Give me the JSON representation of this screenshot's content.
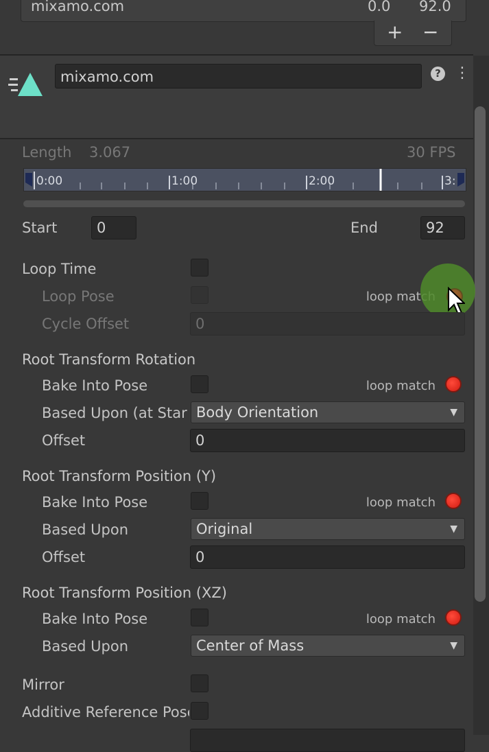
{
  "top_clip": {
    "name": "mixamo.com",
    "start": "0.0",
    "end": "92.0"
  },
  "list_controls": {
    "add": "+",
    "remove": "−"
  },
  "header": {
    "clip_name": "mixamo.com",
    "help_icon": "?",
    "menu_icon": "⋮"
  },
  "timeline": {
    "length_label": "Length",
    "length_value": "3.067",
    "fps": "30 FPS",
    "ticks": [
      "0:00",
      "1:00",
      "2:00",
      "3:"
    ]
  },
  "range": {
    "start_label": "Start",
    "start_value": "0",
    "end_label": "End",
    "end_value": "92"
  },
  "loop": {
    "loop_time_label": "Loop Time",
    "loop_pose_label": "Loop Pose",
    "cycle_offset_label": "Cycle Offset",
    "cycle_offset_value": "0",
    "loop_match_label": "loop match"
  },
  "root_rotation": {
    "title": "Root Transform Rotation",
    "bake_label": "Bake Into Pose",
    "loop_match_label": "loop match",
    "based_upon_label": "Based Upon (at Start)",
    "based_upon_value": "Body Orientation",
    "offset_label": "Offset",
    "offset_value": "0"
  },
  "root_position_y": {
    "title": "Root Transform Position (Y)",
    "bake_label": "Bake Into Pose",
    "loop_match_label": "loop match",
    "based_upon_label": "Based Upon",
    "based_upon_value": "Original",
    "offset_label": "Offset",
    "offset_value": "0"
  },
  "root_position_xz": {
    "title": "Root Transform Position (XZ)",
    "bake_label": "Bake Into Pose",
    "loop_match_label": "loop match",
    "based_upon_label": "Based Upon",
    "based_upon_value": "Center of Mass"
  },
  "mirror_label": "Mirror",
  "additive_label": "Additive Reference Pose",
  "colors": {
    "background": "#383838",
    "loop_red": "#e0261a",
    "cursor_highlight": "#4f8a2a"
  }
}
